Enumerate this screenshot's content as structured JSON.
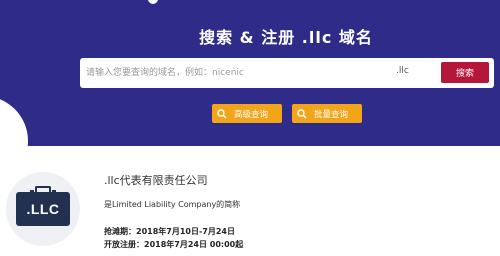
{
  "hero": {
    "title": "搜索 & 注册 .llc 域名",
    "background_color": "#2f2b88"
  },
  "search": {
    "placeholder": "请输入您要查询的域名，例如：nicenic",
    "value": "",
    "tld": ".llc",
    "button_label": "搜索",
    "button_color": "#b4173a"
  },
  "quick_actions": [
    {
      "label": "高级查询",
      "icon": "search-icon"
    },
    {
      "label": "批量查询",
      "icon": "search-icon"
    }
  ],
  "quick_action_color": "#f2a51a",
  "info": {
    "logo_text": ".LLC",
    "logo_icon": "briefcase-icon",
    "title": ".llc代表有限责任公司",
    "description": "是Limited Liability Company的简称",
    "lines": [
      "抢滩期：2018年7月10日-7月24日",
      "开放注册：2018年7月24日 00:00起"
    ]
  }
}
